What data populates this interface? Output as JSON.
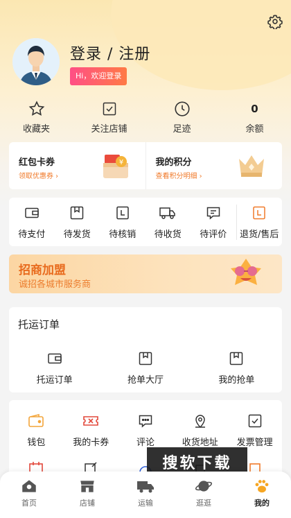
{
  "header": {
    "title": "登录 / 注册",
    "welcome": "Hi，欢迎登录"
  },
  "stats": [
    {
      "label": "收藏夹",
      "icon": "star-icon"
    },
    {
      "label": "关注店铺",
      "icon": "store-check-icon"
    },
    {
      "label": "足迹",
      "icon": "clock-icon"
    },
    {
      "label": "余额",
      "value": "0"
    }
  ],
  "coupon": {
    "left": {
      "title": "红包卡券",
      "link": "领取优惠券 ›"
    },
    "right": {
      "title": "我的积分",
      "link": "查看积分明细 ›"
    }
  },
  "orders": [
    {
      "label": "待支付",
      "icon": "wallet-icon"
    },
    {
      "label": "待发货",
      "icon": "box-icon"
    },
    {
      "label": "待核销",
      "icon": "verify-icon"
    },
    {
      "label": "待收货",
      "icon": "truck-icon"
    },
    {
      "label": "待评价",
      "icon": "comment-icon"
    },
    {
      "label": "退货/售后",
      "icon": "return-icon"
    }
  ],
  "banner": {
    "title": "招商加盟",
    "subtitle": "诚招各城市服务商"
  },
  "tuoyun": {
    "title": "托运订单",
    "items": [
      {
        "label": "托运订单",
        "icon": "wallet-icon"
      },
      {
        "label": "抢单大厅",
        "icon": "box-icon"
      },
      {
        "label": "我的抢单",
        "icon": "box-icon"
      }
    ]
  },
  "tools": [
    {
      "label": "钱包",
      "icon": "wallet-icon"
    },
    {
      "label": "我的卡券",
      "icon": "ticket-icon"
    },
    {
      "label": "评论",
      "icon": "comment-icon"
    },
    {
      "label": "收货地址",
      "icon": "location-icon"
    },
    {
      "label": "发票管理",
      "icon": "invoice-icon"
    }
  ],
  "watermark": "搜软下载",
  "tabs": [
    {
      "label": "首页",
      "icon": "home-icon"
    },
    {
      "label": "店铺",
      "icon": "shop-icon"
    },
    {
      "label": "运输",
      "icon": "truck-icon"
    },
    {
      "label": "逛逛",
      "icon": "planet-icon"
    },
    {
      "label": "我的",
      "icon": "paw-icon",
      "active": true
    }
  ],
  "colors": {
    "accent": "#f07a2a",
    "badge_start": "#ff4f86",
    "badge_end": "#ff7a45",
    "tab_active": "#f6a623"
  }
}
